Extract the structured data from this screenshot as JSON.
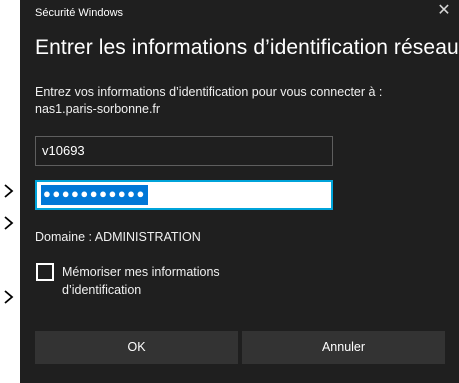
{
  "window": {
    "title": "Sécurité Windows",
    "close_glyph": "✕"
  },
  "dialog": {
    "heading": "Entrer les informations d’identification réseau",
    "prompt_line1": "Entrez vos informations d’identification pour vous connecter à :",
    "prompt_line2": "nas1.paris-sorbonne.fr"
  },
  "fields": {
    "username_value": "v10693",
    "password_mask": "●●●●●●●●●●●"
  },
  "domain_text": "Domaine : ADMINISTRATION",
  "remember": {
    "checked": false,
    "label_line1": "Mémoriser mes informations",
    "label_line2": "d’identification"
  },
  "buttons": {
    "ok_label": "OK",
    "cancel_label": "Annuler"
  },
  "colors": {
    "dialog_bg": "#1f1f1f",
    "button_bg": "#333333",
    "focus_border": "#00a3d9",
    "selection_bg": "#0078d7"
  },
  "icons": {
    "close": "close-icon",
    "checkbox": "checkbox-icon"
  }
}
